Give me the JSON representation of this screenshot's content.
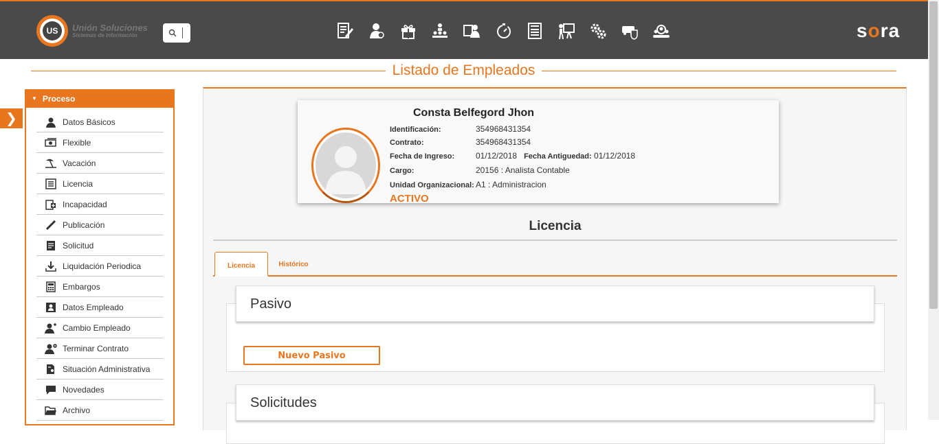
{
  "header": {
    "logo_name": "Unión Soluciones",
    "logo_sub": "Sistemas de Información",
    "logo_mark": "US",
    "brand_prefix": "s",
    "brand_o": "o",
    "brand_suffix": "ra",
    "accent_color": "#e8761f",
    "nav_icons": [
      "document-edit-icon",
      "user-money-icon",
      "gift-icon",
      "org-chart-icon",
      "user-card-icon",
      "stopwatch-icon",
      "list-document-icon",
      "presentation-icon",
      "gears-icon",
      "shield-car-icon",
      "group-search-icon"
    ]
  },
  "page": {
    "title": "Listado de Empleados"
  },
  "menu": {
    "header": "Proceso",
    "items": [
      {
        "label": "Datos Básicos",
        "icon": "user-icon"
      },
      {
        "label": "Flexible",
        "icon": "money-icon"
      },
      {
        "label": "Vacación",
        "icon": "beach-icon"
      },
      {
        "label": "Licencia",
        "icon": "list-icon"
      },
      {
        "label": "Incapacidad",
        "icon": "medical-icon"
      },
      {
        "label": "Publicación",
        "icon": "pen-icon"
      },
      {
        "label": "Solicitud",
        "icon": "form-icon"
      },
      {
        "label": "Liquidación Periodica",
        "icon": "download-icon"
      },
      {
        "label": "Embargos",
        "icon": "calculator-icon"
      },
      {
        "label": "Datos Empleado",
        "icon": "id-card-icon"
      },
      {
        "label": "Cambio Empleado",
        "icon": "user-change-icon"
      },
      {
        "label": "Terminar Contrato",
        "icon": "user-remove-icon"
      },
      {
        "label": "Situación Administrativa",
        "icon": "document-user-icon"
      },
      {
        "label": "Novedades",
        "icon": "chat-icon"
      },
      {
        "label": "Archivo",
        "icon": "folder-icon"
      }
    ]
  },
  "employee": {
    "name": "Consta Belfegord Jhon",
    "id_label": "Identificación:",
    "id_value": "354968431354",
    "contract_label": "Contrato:",
    "contract_value": "354968431354",
    "hire_label": "Fecha de Ingreso:",
    "hire_value": "01/12/2018",
    "seniority_label": "Fecha Antiguedad:",
    "seniority_value": "01/12/2018",
    "position_label": "Cargo:",
    "position_value": "20156 : Analista Contable",
    "unit_label": "Unidad Organizacional:",
    "unit_value": "A1 : Administracion",
    "status": "ACTIVO"
  },
  "section": {
    "title": "Licencia",
    "tabs": [
      "Licencia",
      "Histórico"
    ],
    "active_tab": "Licencia",
    "panel1_title": "Pasivo",
    "new_button": "Nuevo Pasivo",
    "panel2_title": "Solicitudes"
  }
}
